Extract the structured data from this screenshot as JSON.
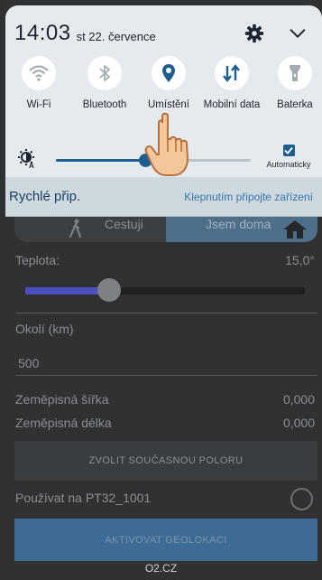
{
  "status": {
    "time": "14:03",
    "date": "st 22. července"
  },
  "quick_toggles": [
    {
      "label": "Wi-Fi",
      "icon": "wifi-icon"
    },
    {
      "label": "Bluetooth",
      "icon": "bluetooth-icon"
    },
    {
      "label": "Umístění",
      "icon": "location-pin-icon"
    },
    {
      "label": "Mobilní data",
      "icon": "mobile-data-icon"
    },
    {
      "label": "Baterka",
      "icon": "flashlight-icon"
    }
  ],
  "brightness": {
    "level": 0.46,
    "auto_label": "Automaticky",
    "auto_checked": true
  },
  "quick_connect": {
    "title": "Rychlé přip.",
    "hint": "Klepnutím připojte zařízení"
  },
  "app": {
    "mode_left": "Cestuji",
    "mode_right": "Jsem doma",
    "temperature_label": "Teplota:",
    "temperature_value": "15,0°",
    "temperature_slider_level": 0.3,
    "radius_label": "Okolí (km)",
    "radius_value": "500",
    "latitude_label": "Zeměpisná šířka",
    "latitude_value": "0,000",
    "longitude_label": "Zeměpisná délka",
    "longitude_value": "0,000",
    "select_location_button": "ZVOLIT SOUČASNOU POLORU",
    "use_on_label": "Používat na PT32_1001",
    "activate_button": "AKTIVOVAT GEOLOKACI"
  },
  "carrier": "O2.CZ",
  "colors": {
    "accent": "#1e5e8e",
    "shade_bg": "#e4eaee",
    "app_bg": "#2f3133"
  }
}
